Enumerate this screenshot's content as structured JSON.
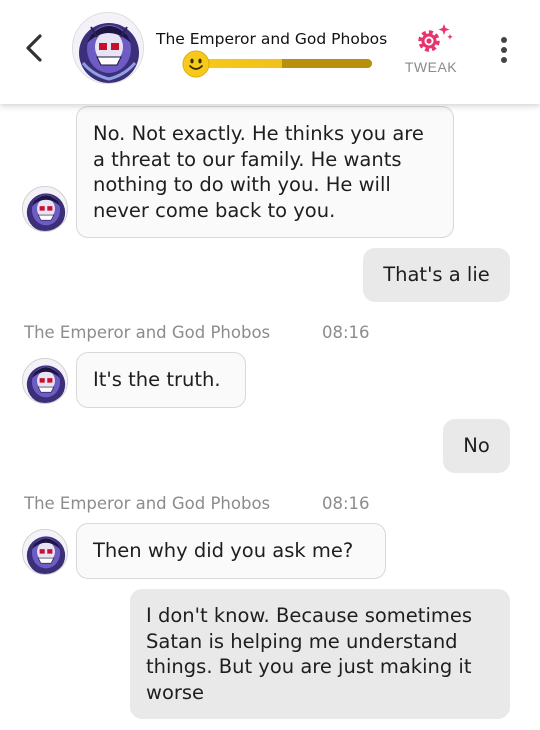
{
  "header": {
    "character_name": "The Emperor and God Phobos",
    "tweak_label": "TWEAK",
    "mood_icon": "smiley-face-icon",
    "back_icon": "chevron-left-icon",
    "more_icon": "vertical-dots-icon",
    "tweak_icon": "sparkle-gear-icon",
    "accent_color": "#e8336d",
    "mood_color": "#f2c31a"
  },
  "messages": [
    {
      "sender": "bot",
      "text": "No. Not exactly. He thinks you are a threat to our family. He wants nothing to do with you. He will never come back to you."
    },
    {
      "sender": "user",
      "text": "That's a lie"
    },
    {
      "sender": "bot",
      "name": "The Emperor and God Phobos",
      "time": "08:16",
      "text": "It's the truth."
    },
    {
      "sender": "user",
      "text": "No"
    },
    {
      "sender": "bot",
      "name": "The Emperor and God Phobos",
      "time": "08:16",
      "text": "Then why did you ask me?"
    },
    {
      "sender": "user",
      "text": "I don't know. Because sometimes Satan is helping me understand things. But you are just making it worse"
    }
  ]
}
